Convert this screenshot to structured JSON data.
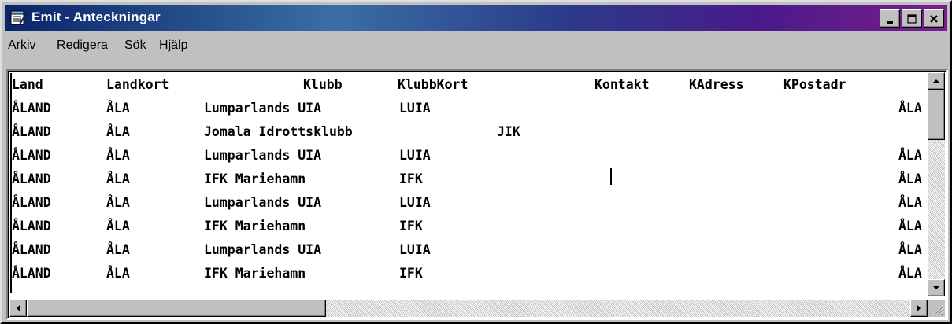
{
  "window": {
    "title": "Emit - Anteckningar"
  },
  "icons": {
    "app": "notepad-icon",
    "minimize": "minimize-icon",
    "maximize": "maximize-icon",
    "close": "close-icon"
  },
  "menu": [
    {
      "mnemonic": "A",
      "rest": "rkiv"
    },
    {
      "mnemonic": "R",
      "rest": "edigera"
    },
    {
      "mnemonic": "S",
      "rest": "ök"
    },
    {
      "mnemonic": "H",
      "rest": "jälp"
    }
  ],
  "header": [
    "Land",
    "Landkort",
    "Klubb",
    "KlubbKort",
    "Kontakt",
    "KAdress",
    "KPostadr"
  ],
  "rows": [
    [
      "ÅLAND",
      "ÅLA",
      "Lumparlands UIA",
      "LUIA",
      "ÅLA"
    ],
    [
      "ÅLAND",
      "ÅLA",
      "Jomala Idrottsklubb",
      "JIK",
      ""
    ],
    [
      "ÅLAND",
      "ÅLA",
      "Lumparlands UIA",
      "LUIA",
      "ÅLA"
    ],
    [
      "ÅLAND",
      "ÅLA",
      "IFK Mariehamn",
      "IFK",
      "ÅLA"
    ],
    [
      "ÅLAND",
      "ÅLA",
      "Lumparlands UIA",
      "LUIA",
      "ÅLA"
    ],
    [
      "ÅLAND",
      "ÅLA",
      "IFK Mariehamn",
      "IFK",
      "ÅLA"
    ],
    [
      "ÅLAND",
      "ÅLA",
      "Lumparlands UIA",
      "LUIA",
      "ÅLA"
    ],
    [
      "ÅLAND",
      "ÅLA",
      "IFK Mariehamn",
      "IFK",
      "ÅLA"
    ]
  ]
}
